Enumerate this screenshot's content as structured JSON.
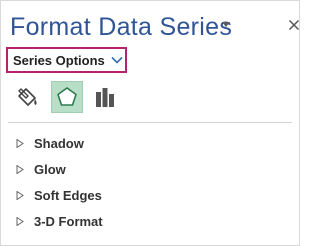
{
  "pane": {
    "title": "Format Data Series",
    "dropdown_icon": "chevron-down-icon",
    "close_icon": "close-icon"
  },
  "series_options": {
    "label": "Series Options",
    "icon": "chevron-down-icon",
    "highlight_color": "#b8216d"
  },
  "tabs": [
    {
      "icon": "paint-bucket-icon",
      "selected": false
    },
    {
      "icon": "pentagon-icon",
      "selected": true,
      "accent": "#b7dec6"
    },
    {
      "icon": "bar-chart-icon",
      "selected": false
    }
  ],
  "sections": [
    {
      "label": "Shadow",
      "icon": "triangle-right-icon"
    },
    {
      "label": "Glow",
      "icon": "triangle-right-icon"
    },
    {
      "label": "Soft Edges",
      "icon": "triangle-right-icon"
    },
    {
      "label": "3-D Format",
      "icon": "triangle-right-icon"
    }
  ],
  "colors": {
    "title": "#2f5597",
    "text": "#333333"
  }
}
